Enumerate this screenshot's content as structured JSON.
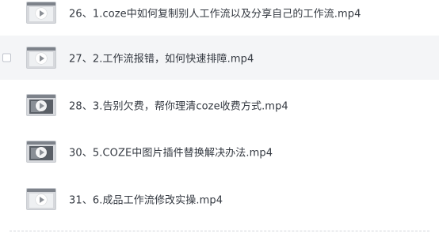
{
  "files": [
    {
      "name": "26、1.coze中如何复制别人工作流以及分享自己的工作流.mp4",
      "hovered": false,
      "thumb": "light"
    },
    {
      "name": "27、2.工作流报错，如何快速排障.mp4",
      "hovered": true,
      "thumb": "light"
    },
    {
      "name": "28、3.告别欠费，帮你理清coze收费方式.mp4",
      "hovered": false,
      "thumb": "dark"
    },
    {
      "name": "30、5.COZE中图片插件替换解决办法.mp4",
      "hovered": false,
      "thumb": "dark"
    },
    {
      "name": "31、6.成品工作流修改实操.mp4",
      "hovered": false,
      "thumb": "light"
    }
  ],
  "icons": {
    "thumbnail": "video-thumbnail-icon",
    "play": "play-icon",
    "checkbox": "checkbox-icon"
  },
  "colors": {
    "hover_background": "#f4f5f7",
    "text": "#333840"
  }
}
